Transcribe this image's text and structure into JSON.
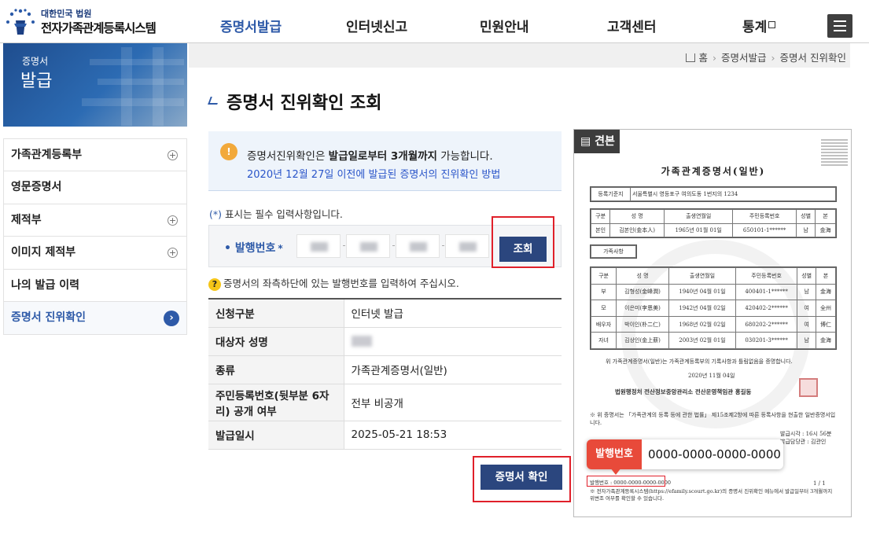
{
  "header": {
    "logo_line1": "대한민국 법원",
    "logo_line2": "전자가족관계등록시스템",
    "nav": [
      "증명서발급",
      "인터넷신고",
      "민원안내",
      "고객센터",
      "통계"
    ],
    "active_nav": "증명서발급"
  },
  "banner": {
    "line1": "증명서",
    "line2": "발급"
  },
  "sidebar": {
    "items": [
      {
        "label": "가족관계등록부",
        "expand": "+"
      },
      {
        "label": "영문증명서"
      },
      {
        "label": "제적부",
        "expand": "+"
      },
      {
        "label": "이미지 제적부",
        "expand": "+"
      },
      {
        "label": "나의 발급 이력"
      },
      {
        "label": "증명서 진위확인",
        "active": true
      }
    ]
  },
  "breadcrumb": [
    "홈",
    "증명서발급",
    "증명서 진위확인"
  ],
  "page_title": "증명서 진위확인 조회",
  "notice": {
    "icon": "!",
    "pre": "증명서진위확인은 ",
    "bold": "발급일로부터 3개월까지",
    "post": " 가능합니다.",
    "link": "2020년 12월 27일 이전에 발급된 증명서의 진위확인 방법"
  },
  "required_note": {
    "star": "(*)",
    "text": " 표시는 필수 입력사항입니다."
  },
  "issue_input": {
    "label": "• 발행번호",
    "req": "*",
    "search_label": "조회"
  },
  "help_text": "증명서의 좌측하단에 있는 발행번호를 입력하여 주십시오.",
  "info_rows": [
    {
      "label": "신청구분",
      "value": "인터넷 발급"
    },
    {
      "label": "대상자 성명",
      "value": ""
    },
    {
      "label": "종류",
      "value": "가족관계증명서(일반)"
    },
    {
      "label": "주민등록번호(뒷부분 6자리) 공개 여부",
      "value": "전부 비공개"
    },
    {
      "label": "발급일시",
      "value": "2025-05-21 18:53"
    }
  ],
  "confirm_label": "증명서 확인",
  "sample": {
    "badge": "견본",
    "doc_title": "가족관계증명서(일반)",
    "reg_label": "등록기준지",
    "reg_value": "서울특별시 영등포구 여의도동 1번지의 1234",
    "person_headers": [
      "구분",
      "성 명",
      "출생연월일",
      "주민등록번호",
      "성별",
      "본"
    ],
    "person_row": [
      "본인",
      "김본인(金本人)",
      "1965년 01월 01일",
      "650101-1******",
      "남",
      "金海"
    ],
    "family_label": "가족사항",
    "family_rows": [
      [
        "부",
        "김형성(金峰潤)",
        "1940년 04월 01일",
        "400401-1******",
        "남",
        "金海"
      ],
      [
        "모",
        "이은미(李恩美)",
        "1942년 04월 02일",
        "420402-2******",
        "여",
        "全州"
      ],
      [
        "배우자",
        "박이인(朴二仁)",
        "1968년 02월 02일",
        "680202-2******",
        "여",
        "博仁"
      ],
      [
        "자녀",
        "김상인(金上薪)",
        "2003년 02월 01일",
        "030201-3******",
        "남",
        "金海"
      ]
    ],
    "certify_text": "위 가족관계증명서(일반)는 가족관계등록부의 기록사항과 틀림없음을 증명합니다.",
    "date": "2020년 11월 04일",
    "issuer": "법원행정처 전산정보중앙관리소 전산운영책임관 홍길동",
    "law_note": "※ 위 증명서는 「가족관계의 등록 등에 관한 법률」 제15조제2항에 따른 등록사항을 현출한 일반증명서입니다.",
    "issue_time": "발급시각 : 16시 56분",
    "issuer_small": "발급담당관 : 김관인",
    "callout_label": "발행번호",
    "callout_value": "0000-0000-0000-0000",
    "issue_no_small": "발행번호 : 0000-0000-0000-0000",
    "page": "1 / 1",
    "footer_note": "※ 전자가족관계등록시스템(https://efamily.scourt.go.kr)의 증명서 진위확인 메뉴에서 발급일부터 3개월까지 위변조 여부를 확인할 수 있습니다."
  },
  "colors": {
    "primary": "#2b467e",
    "accent": "#2e5aa8",
    "highlight": "#e0202a",
    "callout": "#e84a3a"
  }
}
